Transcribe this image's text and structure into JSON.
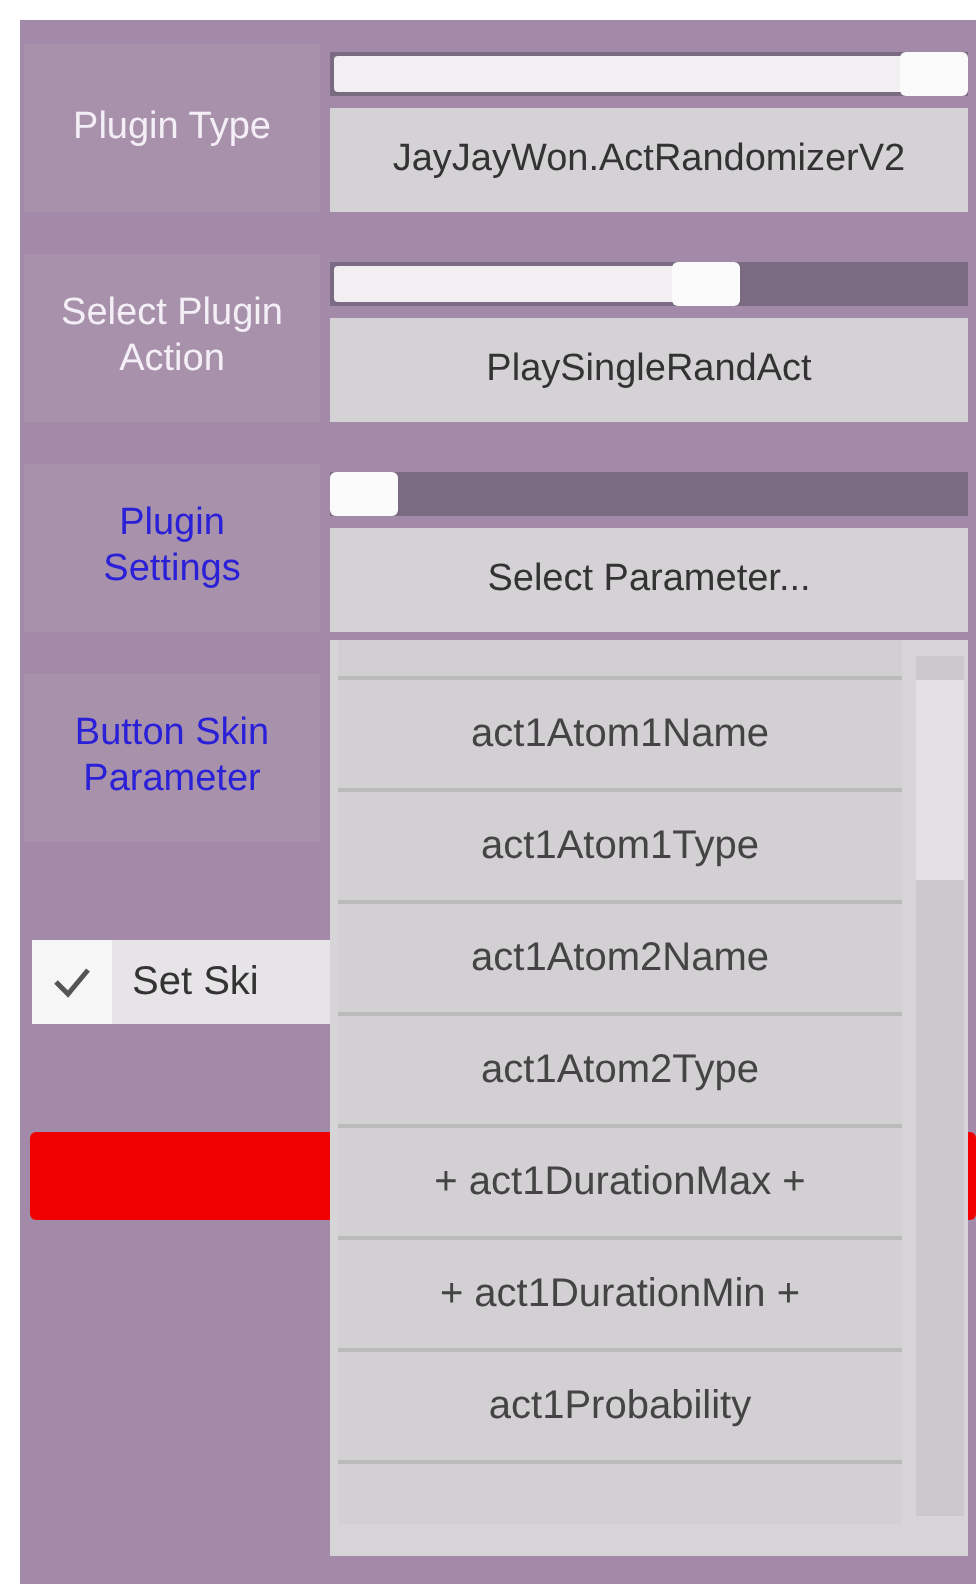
{
  "rows": [
    {
      "label": "Plugin Type",
      "highlighted": false,
      "slider": {
        "level": 1.0
      },
      "dropdown": "JayJayWon.ActRandomizerV2"
    },
    {
      "label": "Select Plugin Action",
      "highlighted": false,
      "slider": {
        "level": 0.6
      },
      "dropdown": "PlaySingleRandAct"
    },
    {
      "label": "Plugin Settings",
      "highlighted": true,
      "slider": {
        "level": 0.0
      },
      "dropdown": "Select Parameter..."
    },
    {
      "label": "Button Skin Parameter",
      "highlighted": true
    }
  ],
  "checkbox": {
    "label": "Set Ski",
    "checked": true
  },
  "dropdown_list": {
    "items": [
      "act1Atom1Name",
      "act1Atom1Type",
      "act1Atom2Name",
      "act1Atom2Type",
      "+ act1DurationMax +",
      "+ act1DurationMin +",
      "act1Probability"
    ]
  }
}
